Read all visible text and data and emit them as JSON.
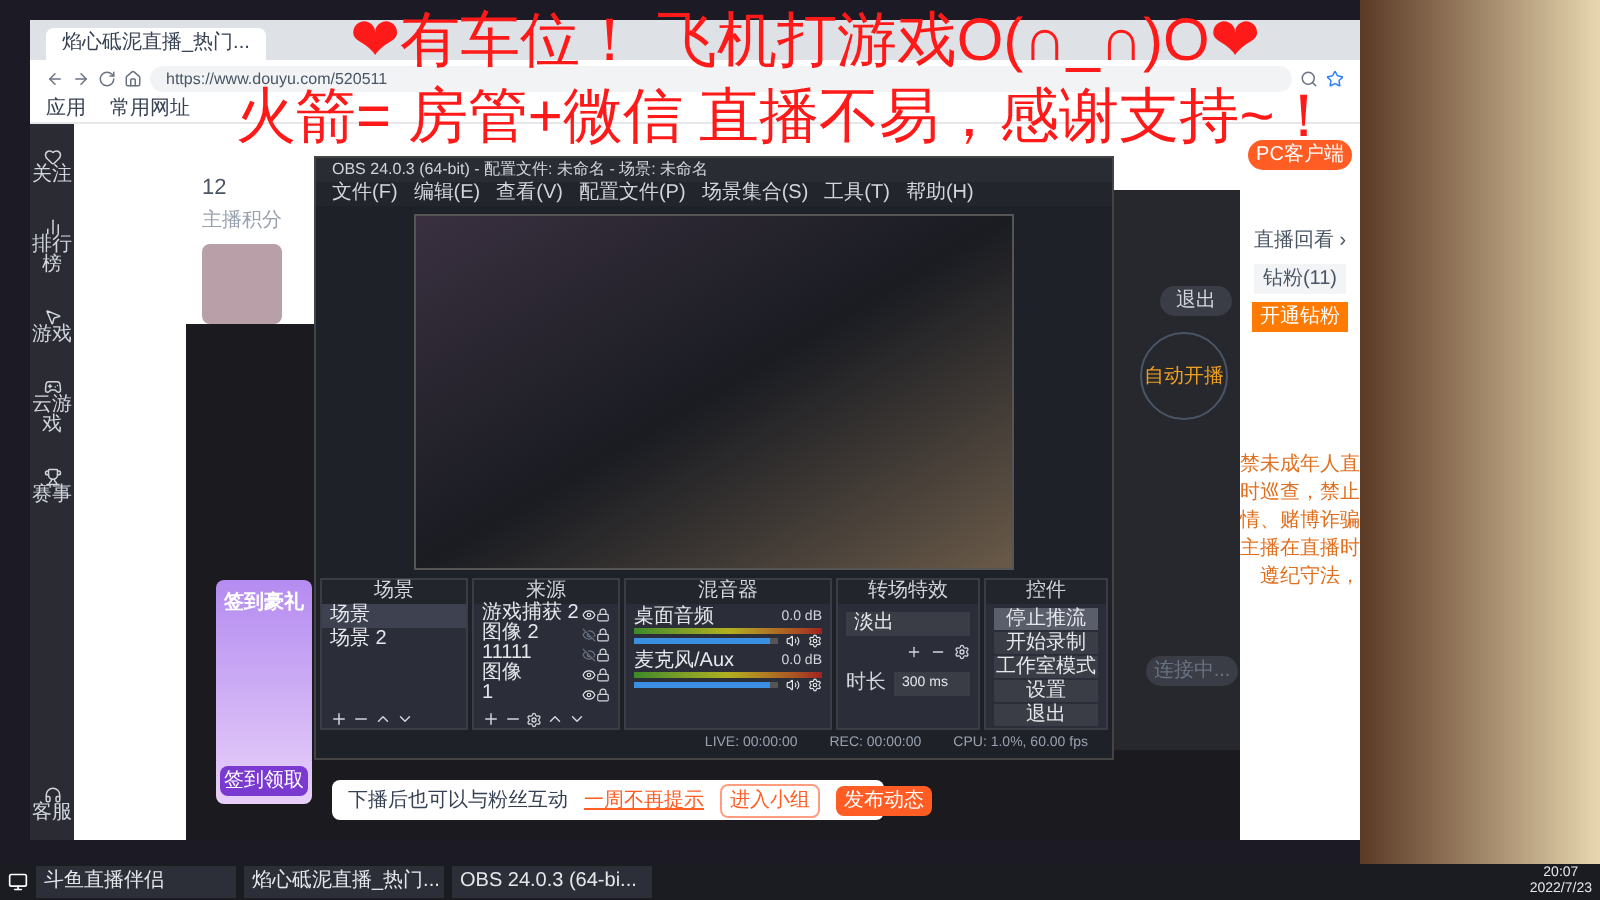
{
  "overlay_text": [
    "❤有车位！ 飞机打游戏O(∩_∩)O❤",
    "火箭= 房管+微信 直播不易，感谢支持~！"
  ],
  "browser": {
    "tab_title": "焰心砥泥直播_热门...",
    "url": "https://www.douyu.com/520511",
    "bookmarks": [
      "应用",
      "常用网址"
    ]
  },
  "douyu": {
    "nav": [
      "关注",
      "排行榜",
      "游戏",
      "云游戏",
      "赛事"
    ],
    "service": "客服",
    "score": "12",
    "score_label": "主播积分",
    "pc_client": "PC客户端",
    "replay": "直播回看 ›",
    "fans_tab": "钻粉(11)",
    "open_fans": "开通钻粉",
    "notice": [
      "禁未成年人直",
      "时巡查，禁止",
      "情、赌博诈骗",
      "主播在直播时",
      "遵纪守法，"
    ]
  },
  "signin": {
    "title": "签到豪礼",
    "button": "签到领取"
  },
  "companion": {
    "exit": "退出",
    "auto": "自动开播",
    "status": "连接中..."
  },
  "obs": {
    "title": "OBS 24.0.3 (64-bit) - 配置文件: 未命名 - 场景: 未命名",
    "menu": [
      "文件(F)",
      "编辑(E)",
      "查看(V)",
      "配置文件(P)",
      "场景集合(S)",
      "工具(T)",
      "帮助(H)"
    ],
    "scenes": {
      "title": "场景",
      "items": [
        {
          "label": "场景",
          "selected": true
        },
        {
          "label": "场景 2",
          "selected": false
        }
      ]
    },
    "sources": {
      "title": "来源",
      "items": [
        {
          "label": "游戏捕获 2",
          "visible": true
        },
        {
          "label": "图像 2",
          "visible": false
        },
        {
          "label": "11111",
          "visible": false
        },
        {
          "label": "图像",
          "visible": true
        },
        {
          "label": "1",
          "visible": true
        }
      ]
    },
    "mixer": {
      "title": "混音器",
      "channels": [
        {
          "name": "桌面音频",
          "reading": "0.0 dB",
          "level": 0.95
        },
        {
          "name": "麦克风/Aux",
          "reading": "0.0 dB",
          "level": 0.95
        }
      ]
    },
    "transitions": {
      "title": "转场特效",
      "effect": "淡出",
      "duration_label": "时长",
      "duration": "300 ms"
    },
    "controls": {
      "title": "控件",
      "buttons": [
        {
          "label": "停止推流",
          "selected": true
        },
        {
          "label": "开始录制",
          "selected": false
        },
        {
          "label": "工作室模式",
          "selected": false
        },
        {
          "label": "设置",
          "selected": false
        },
        {
          "label": "退出",
          "selected": false
        }
      ]
    },
    "status": [
      "LIVE: 00:00:00",
      "REC: 00:00:00",
      "CPU: 1.0%, 60.00 fps"
    ]
  },
  "toast": {
    "message": "下播后也可以与粉丝互动",
    "dismiss": "一周不再提示",
    "join": "进入小组",
    "post": "发布动态"
  },
  "taskbar": {
    "apps": [
      "斗鱼直播伴侣",
      "焰心砥泥直播_热门...",
      "OBS 24.0.3 (64-bi..."
    ],
    "time": "20:07",
    "date": "2022/7/23"
  }
}
